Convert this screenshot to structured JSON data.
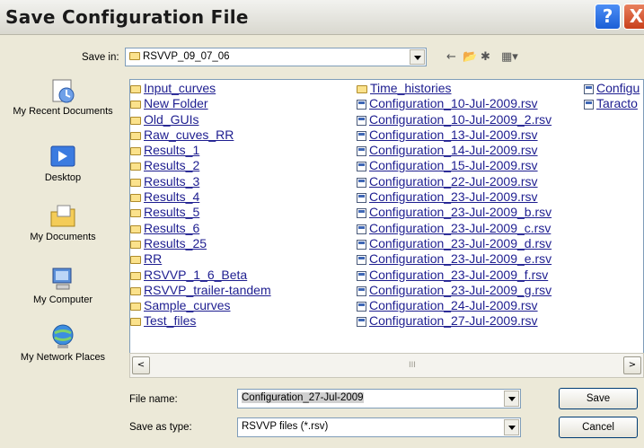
{
  "window": {
    "title": "Save Configuration File",
    "help_label": "?",
    "close_label": "X"
  },
  "save_in": {
    "label": "Save in:",
    "value": "RSVVP_09_07_06"
  },
  "places": [
    {
      "label": "My Recent Documents",
      "icon": "recent-documents-icon"
    },
    {
      "label": "Desktop",
      "icon": "desktop-icon"
    },
    {
      "label": "My Documents",
      "icon": "my-documents-icon"
    },
    {
      "label": "My Computer",
      "icon": "my-computer-icon"
    },
    {
      "label": "My Network Places",
      "icon": "network-places-icon"
    }
  ],
  "files": {
    "col1": [
      {
        "name": "Input_curves",
        "type": "folder"
      },
      {
        "name": "New Folder",
        "type": "folder"
      },
      {
        "name": "Old_GUIs",
        "type": "folder"
      },
      {
        "name": "Raw_cuves_RR",
        "type": "folder"
      },
      {
        "name": "Results_1",
        "type": "folder"
      },
      {
        "name": "Results_2",
        "type": "folder"
      },
      {
        "name": "Results_3",
        "type": "folder"
      },
      {
        "name": "Results_4",
        "type": "folder"
      },
      {
        "name": "Results_5",
        "type": "folder"
      },
      {
        "name": "Results_6",
        "type": "folder"
      },
      {
        "name": "Results_25",
        "type": "folder"
      },
      {
        "name": "RR",
        "type": "folder"
      },
      {
        "name": "RSVVP_1_6_Beta",
        "type": "folder"
      },
      {
        "name": "RSVVP_trailer-tandem",
        "type": "folder"
      },
      {
        "name": "Sample_curves",
        "type": "folder"
      },
      {
        "name": "Test_files",
        "type": "folder"
      }
    ],
    "col2": [
      {
        "name": "Time_histories",
        "type": "folder"
      },
      {
        "name": "Configuration_10-Jul-2009.rsv",
        "type": "file"
      },
      {
        "name": "Configuration_10-Jul-2009_2.rsv",
        "type": "file"
      },
      {
        "name": "Configuration_13-Jul-2009.rsv",
        "type": "file"
      },
      {
        "name": "Configuration_14-Jul-2009.rsv",
        "type": "file"
      },
      {
        "name": "Configuration_15-Jul-2009.rsv",
        "type": "file"
      },
      {
        "name": "Configuration_22-Jul-2009.rsv",
        "type": "file"
      },
      {
        "name": "Configuration_23-Jul-2009.rsv",
        "type": "file"
      },
      {
        "name": "Configuration_23-Jul-2009_b.rsv",
        "type": "file"
      },
      {
        "name": "Configuration_23-Jul-2009_c.rsv",
        "type": "file"
      },
      {
        "name": "Configuration_23-Jul-2009_d.rsv",
        "type": "file"
      },
      {
        "name": "Configuration_23-Jul-2009_e.rsv",
        "type": "file"
      },
      {
        "name": "Configuration_23-Jul-2009_f.rsv",
        "type": "file"
      },
      {
        "name": "Configuration_23-Jul-2009_g.rsv",
        "type": "file"
      },
      {
        "name": "Configuration_24-Jul-2009.rsv",
        "type": "file"
      },
      {
        "name": "Configuration_27-Jul-2009.rsv",
        "type": "file"
      }
    ],
    "col3": [
      {
        "name": "Configu",
        "type": "file"
      },
      {
        "name": "Taracto",
        "type": "file"
      }
    ]
  },
  "scrollbar": {
    "left_label": "<",
    "right_label": ">",
    "thumb_label": "III"
  },
  "file_name": {
    "label": "File name:",
    "value": "Configuration_27-Jul-2009"
  },
  "save_as_type": {
    "label": "Save as type:",
    "value": "RSVVP files (*.rsv)"
  },
  "buttons": {
    "save": "Save",
    "cancel": "Cancel"
  }
}
